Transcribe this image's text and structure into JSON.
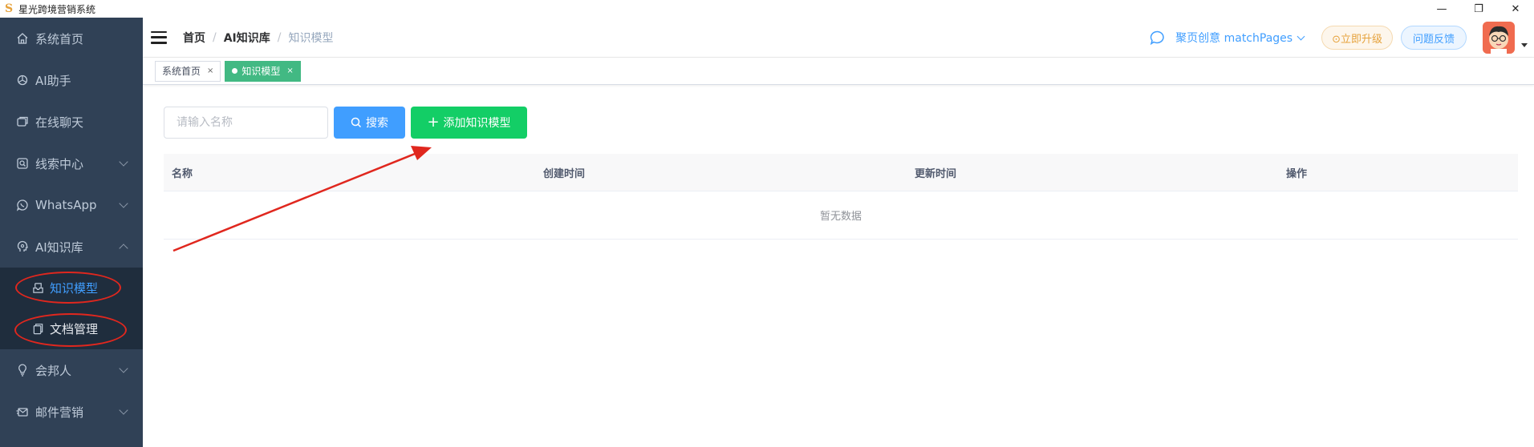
{
  "window": {
    "title": "星光跨境营销系统",
    "logo_glyph": "S",
    "min_glyph": "—",
    "restore_glyph": "❐",
    "close_glyph": "✕"
  },
  "sidebar": {
    "items": [
      {
        "label": "系统首页",
        "icon": "home-icon"
      },
      {
        "label": "AI助手",
        "icon": "openai-icon"
      },
      {
        "label": "在线聊天",
        "icon": "chat-icon"
      },
      {
        "label": "线索中心",
        "icon": "leads-icon",
        "expandable": true
      },
      {
        "label": "WhatsApp",
        "icon": "whatsapp-icon",
        "expandable": true
      },
      {
        "label": "AI知识库",
        "icon": "brain-icon",
        "expandable": true,
        "expanded": true
      },
      {
        "label": "会邦人",
        "icon": "lightbulb-icon",
        "expandable": true
      },
      {
        "label": "邮件营销",
        "icon": "mail-send-icon",
        "expandable": true
      }
    ],
    "subitems": [
      {
        "label": "知识模型",
        "icon": "inbox-icon",
        "active": true
      },
      {
        "label": "文档管理",
        "icon": "document-icon"
      }
    ]
  },
  "header": {
    "breadcrumb": [
      "首页",
      "AI知识库",
      "知识模型"
    ],
    "separator": "/",
    "chat_label": "聚页创意 matchPages",
    "upgrade_label": "⊙立即升级",
    "feedback_label": "问题反馈"
  },
  "tags": [
    {
      "label": "系统首页",
      "close": "×"
    },
    {
      "label": "知识模型",
      "close": "×",
      "active": true
    }
  ],
  "content": {
    "search_placeholder": "请输入名称",
    "search_value": "",
    "search_button": "搜索",
    "add_button": "添加知识模型",
    "add_plus": "+",
    "table_headers": [
      "名称",
      "创建时间",
      "更新时间",
      "操作"
    ],
    "empty_text": "暂无数据"
  },
  "colors": {
    "sidebar_bg": "#304156",
    "submenu_bg": "#1f2d3d",
    "active_blue": "#409eff",
    "add_green": "#13ce66",
    "tag_green": "#42b983",
    "annotation_red": "#e0271e"
  }
}
